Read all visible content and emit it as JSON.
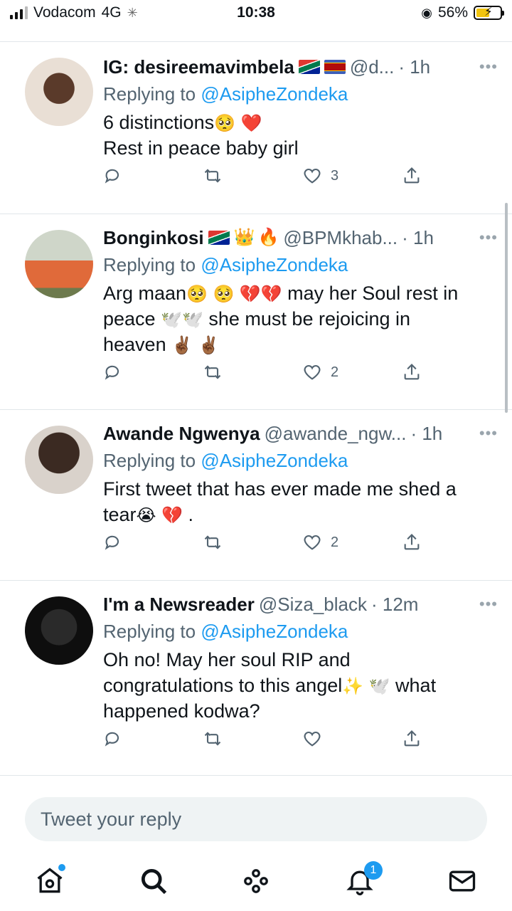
{
  "status_bar": {
    "carrier": "Vodacom",
    "network": "4G",
    "time": "10:38",
    "battery": "56%",
    "battery_level": 0.56
  },
  "tweets": [
    {
      "name": "IG: desireemavimbela",
      "handle": "@d...",
      "time": "· 1h",
      "replying_label": "Replying to",
      "replying_to": "@AsipheZondeka",
      "line1": "6 distinctions",
      "line2": "Rest in peace baby girl",
      "likes": "3"
    },
    {
      "name": "Bonginkosi",
      "handle": "@BPMkhab...",
      "time": "· 1h",
      "replying_label": "Replying to",
      "replying_to": "@AsipheZondeka",
      "line1a": "Arg maan",
      "line1b": "may her Soul rest in",
      "line2a": "peace",
      "line2b": "she must be rejoicing in",
      "line3": "heaven",
      "likes": "2"
    },
    {
      "name": "Awande Ngwenya",
      "handle": "@awande_ngw...",
      "time": "· 1h",
      "replying_label": "Replying to",
      "replying_to": "@AsipheZondeka",
      "line1": "First tweet that has ever made me shed a",
      "line2a": "tear",
      "line2b": ".",
      "likes": "2"
    },
    {
      "name": "I'm a Newsreader",
      "handle": "@Siza_black",
      "time": "· 12m",
      "replying_label": "Replying to",
      "replying_to": "@AsipheZondeka",
      "line1": "Oh no! May her soul RIP and",
      "line2a": "congratulations to this angel",
      "line2b": "what",
      "line3": "happened kodwa?"
    }
  ],
  "more_glyph": "•••",
  "reply_box": {
    "placeholder": "Tweet your reply"
  },
  "nav": {
    "notifications_badge": "1"
  },
  "colors": {
    "accent": "#1d9bf0",
    "secondary_text": "#536471"
  }
}
